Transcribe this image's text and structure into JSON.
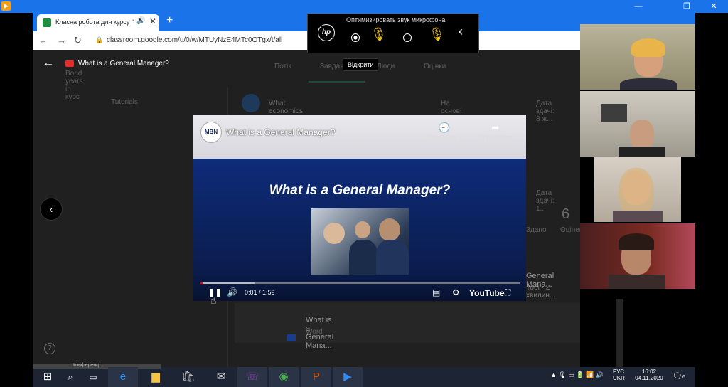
{
  "browser": {
    "tab_title": "Класна робота для курсу \"Г",
    "url": "classroom.google.com/u/0/w/MTUyNzE4MTc0OTgx/t/all"
  },
  "classroom": {
    "tabs": [
      "Потік",
      "Завдання",
      "Люди",
      "Оцінки"
    ],
    "topic": "Tutorials",
    "subtitle": "Bond years in курс",
    "item1_title": "What economics is about?",
    "item1_meta": "На основі вправ...",
    "item1_due": "Дата здачі: 8 ж...",
    "due2": "Дата здачі: 1...",
    "count": "6",
    "count_label": "Оцінен",
    "count_sub": "Здано",
    "item2_title": "General Mana...",
    "item2_meta": "Тобі · 2 хвилин...",
    "item3_title": "What is a General Mana...",
    "item3_meta": "Word"
  },
  "youtube": {
    "header_title": "What is a General Manager?",
    "video_title": "What is a General Manager?",
    "watch_later": "Переглян...",
    "share": "Поділитися",
    "headline": "What is a General Manager?",
    "time": "0:01 / 1:59",
    "brand": "YouTube",
    "progress_fraction": 0.01,
    "buffer_fraction": 0.17,
    "channel_logo": "MBN"
  },
  "hp_popup": {
    "label": "Оптимизировать звук микрофона",
    "logo": "hp",
    "tooltip": "Відкрити"
  },
  "taskbar": {
    "lang": "РУС",
    "lang2": "UKR",
    "time": "16:02",
    "date": "04.11.2020",
    "notifications": "6",
    "conference_label": "Конференц..."
  },
  "colors": {
    "accent": "#1a73e8",
    "youtube_red": "#ff0000",
    "video_bg": "#0f2a6e"
  }
}
